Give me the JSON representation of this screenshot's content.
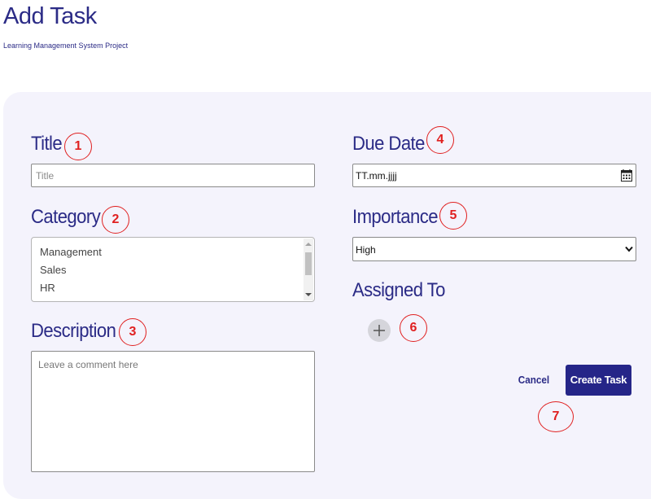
{
  "header": {
    "title": "Add Task",
    "subtitle": "Learning Management System Project"
  },
  "form": {
    "title": {
      "label": "Title",
      "placeholder": "Title",
      "value": ""
    },
    "due_date": {
      "label": "Due Date",
      "value": "TT.mm.jjjj",
      "icon": "calendar-icon"
    },
    "category": {
      "label": "Category",
      "options": [
        "Management",
        "Sales",
        "HR"
      ]
    },
    "importance": {
      "label": "Importance",
      "selected": "High",
      "icon": "chevron-down-icon"
    },
    "description": {
      "label": "Description",
      "placeholder": "Leave a comment here",
      "value": ""
    },
    "assigned_to": {
      "label": "Assigned To",
      "icon": "plus-icon"
    },
    "actions": {
      "cancel_label": "Cancel",
      "create_label": "Create Task"
    }
  },
  "annotations": [
    "1",
    "2",
    "3",
    "4",
    "5",
    "6",
    "7"
  ],
  "colors": {
    "accent": "#2b2b86",
    "primary_button": "#252588",
    "panel_background": "#f4f3fc",
    "annotation": "#e02020"
  }
}
